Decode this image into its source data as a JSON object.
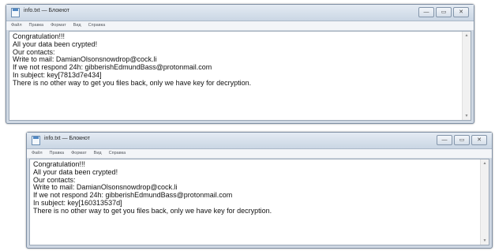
{
  "window1": {
    "title": "info.txt — Блокнот",
    "controls": {
      "minimize": "—",
      "maximize": "▭",
      "close": "✕"
    },
    "menu": [
      "Файл",
      "Правка",
      "Формат",
      "Вид",
      "Справка"
    ],
    "lines": [
      "Congratulation!!!",
      "All your data been crypted!",
      "Our contacts:",
      "Write to mail: DamianOlsonsnowdrop@cock.li",
      "If we not respond 24h: gibberishEdmundBass@protonmail.com",
      "In subject: key[7813d7e434]",
      "There is no other way to get you files back, only we have key for decryption."
    ]
  },
  "window2": {
    "title": "info.txt — Блокнот",
    "controls": {
      "minimize": "—",
      "maximize": "▭",
      "close": "✕"
    },
    "menu": [
      "Файл",
      "Правка",
      "Формат",
      "Вид",
      "Справка"
    ],
    "lines": [
      "Congratulation!!!",
      "All your data been crypted!",
      "Our contacts:",
      "Write to mail: DamianOlsonsnowdrop@cock.li",
      "If we not respond 24h: gibberishEdmundBass@protonmail.com",
      "In subject: key[160313537d]",
      "There is no other way to get you files back, only we have key for decryption."
    ]
  }
}
